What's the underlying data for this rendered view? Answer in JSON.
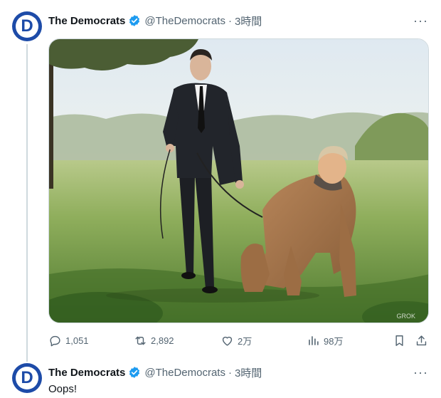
{
  "tweet": {
    "display_name": "The Democrats",
    "handle": "@TheDemocrats",
    "separator": "·",
    "time": "3時間",
    "more_label": "···",
    "avatar_letter": "D",
    "image_watermark": "GROK",
    "stats": {
      "replies": "1,051",
      "reposts": "2,892",
      "likes": "2万",
      "views": "98万"
    }
  },
  "reply": {
    "display_name": "The Democrats",
    "handle": "@TheDemocrats",
    "separator": "·",
    "time": "3時間",
    "more_label": "···",
    "avatar_letter": "D",
    "text": "Oops!"
  },
  "colors": {
    "brand_blue": "#1d4ba8",
    "verified_blue": "#1d9bf0",
    "muted_text": "#536471",
    "divider": "#cfd9de"
  }
}
